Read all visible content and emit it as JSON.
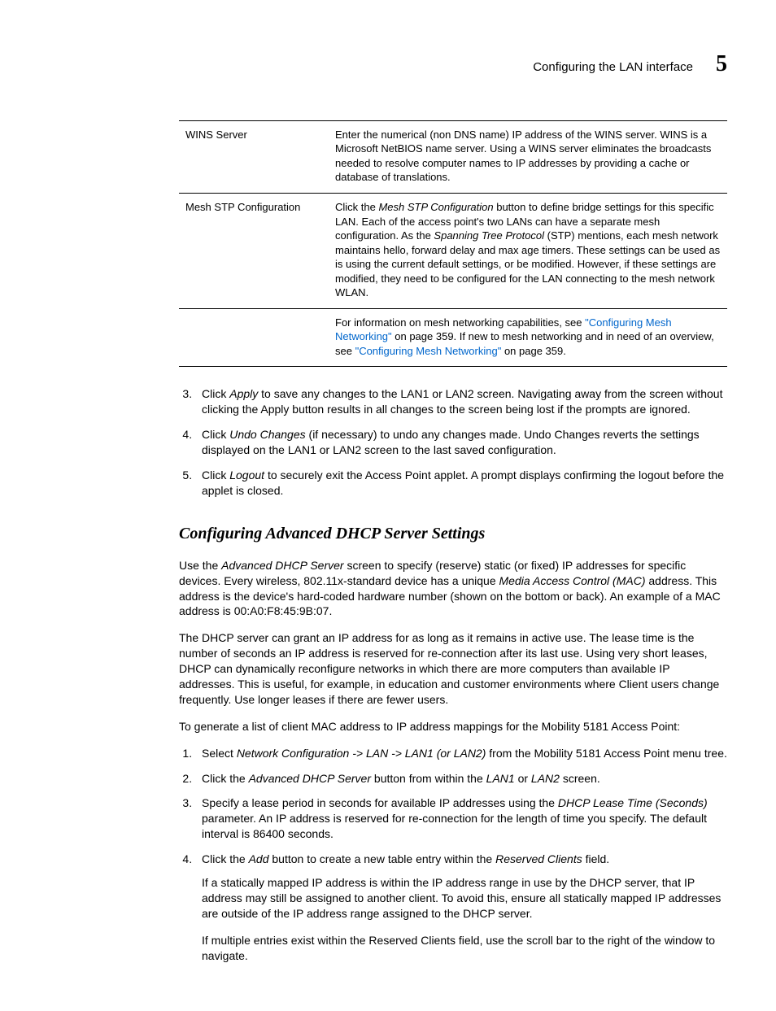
{
  "header": {
    "running_title": "Configuring the LAN interface",
    "chapter_number": "5"
  },
  "table": {
    "rows": [
      {
        "term": "WINS Server",
        "desc": "Enter the numerical (non DNS name) IP address of the WINS server. WINS is a Microsoft NetBIOS name server. Using a WINS server eliminates the broadcasts needed to resolve computer names to IP addresses by providing a cache or database of translations."
      },
      {
        "term": "Mesh STP Configuration",
        "desc_pre": "Click the ",
        "desc_em1": "Mesh STP Configuration",
        "desc_mid1": " button to define bridge settings for this specific LAN. Each of the access point's two LANs can have a separate mesh configuration. As the ",
        "desc_em2": "Spanning Tree Protocol",
        "desc_mid2": " (STP) mentions, each mesh network maintains hello, forward delay and max age timers. These settings can be used as is using the current default settings, or be modified. However, if these settings are modified, they need to be configured for the LAN connecting to the mesh network WLAN.",
        "desc_line2_pre": "For information on mesh networking capabilities, see ",
        "desc_link1": "\"Configuring Mesh Networking\"",
        "desc_line2_mid": " on page 359. If new to mesh networking and in need of an overview, see ",
        "desc_link2": "\"Configuring Mesh Networking\"",
        "desc_line2_post": " on page 359."
      }
    ]
  },
  "steps_a": [
    {
      "pre": "Click ",
      "em": "Apply",
      "post": " to save any changes to the LAN1 or LAN2 screen. Navigating away from the screen without clicking the Apply button results in all changes to the screen being lost if the prompts are ignored."
    },
    {
      "pre": "Click ",
      "em": "Undo Changes",
      "post": " (if necessary) to undo any changes made. Undo Changes reverts the settings displayed on the LAN1 or LAN2 screen to the last saved configuration."
    },
    {
      "pre": "Click ",
      "em": "Logout",
      "post": " to securely exit the Access Point applet. A prompt displays confirming the logout before the applet is closed."
    }
  ],
  "section_heading": "Configuring Advanced DHCP Server Settings",
  "body_paras": {
    "p1_pre": "Use the ",
    "p1_em1": "Advanced DHCP Server",
    "p1_mid": " screen to specify (reserve) static (or fixed) IP addresses for specific devices. Every wireless, 802.11x-standard device has a unique ",
    "p1_em2": "Media Access Control (MAC)",
    "p1_post": " address. This address is the device's hard-coded hardware number (shown on the bottom or back). An example of a MAC address is 00:A0:F8:45:9B:07.",
    "p2": "The DHCP server can grant an IP address for as long as it remains in active use. The lease time is the number of seconds an IP address is reserved for re-connection after its last use. Using very short leases, DHCP can dynamically reconfigure networks in which there are more computers than available IP addresses. This is useful, for example, in education and customer environments where Client users change frequently. Use longer leases if there are fewer users.",
    "p3": "To generate a list of client MAC address to IP address mappings for the Mobility 5181 Access Point:"
  },
  "steps_b": [
    {
      "pre": "Select ",
      "em": "Network Configuration -> LAN -> LAN1 (or LAN2)",
      "post": " from the Mobility 5181 Access Point menu tree."
    },
    {
      "pre": "Click the ",
      "em": "Advanced DHCP Server",
      "mid": " button from within the ",
      "em2": "LAN1",
      "mid2": " or ",
      "em3": "LAN2",
      "post": " screen."
    },
    {
      "pre": "Specify a lease period in seconds for available IP addresses using the ",
      "em": "DHCP Lease Time (Seconds)",
      "post": " parameter. An IP address is reserved for re-connection for the length of time you specify. The default interval is 86400 seconds."
    },
    {
      "pre": "Click the ",
      "em": "Add",
      "mid": " button to create a new table entry within the ",
      "em2": "Reserved Clients",
      "post": " field.",
      "sub1": "If a statically mapped IP address is within the IP address range in use by the DHCP server, that IP address may still be assigned to another client. To avoid this, ensure all statically mapped IP addresses are outside of the IP address range assigned to the DHCP server.",
      "sub2": "If multiple entries exist within the Reserved Clients field, use the scroll bar to the right of the window to navigate."
    }
  ]
}
